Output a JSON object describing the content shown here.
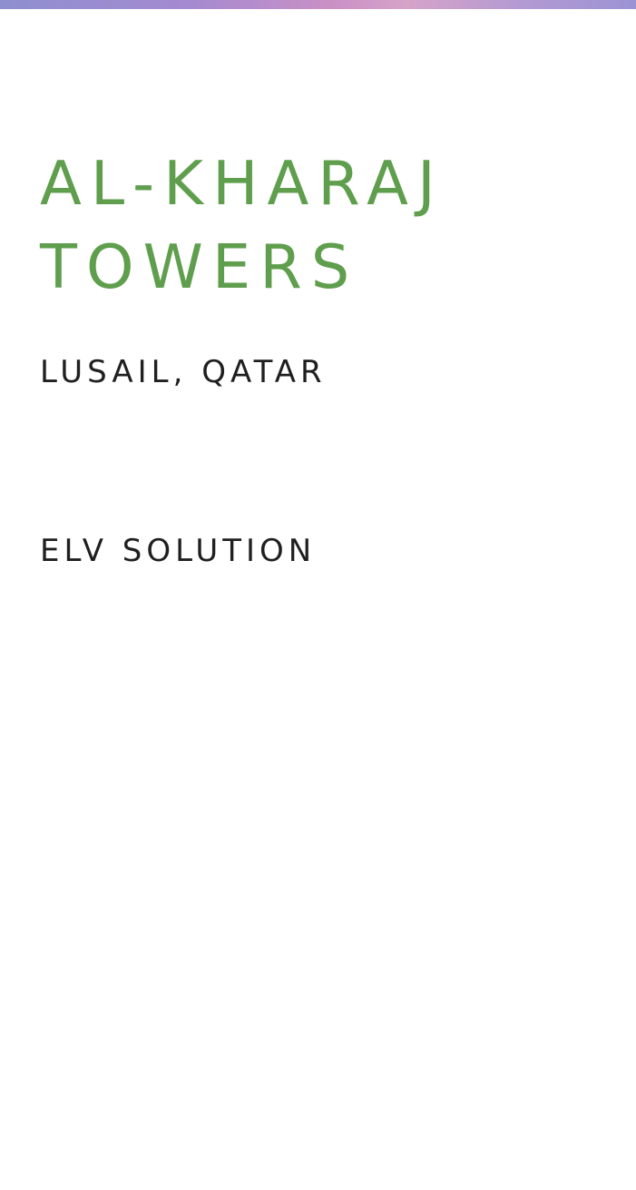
{
  "project": {
    "title_line_1": "AL-KHARAJ",
    "title_line_2": "TOWERS",
    "location": "LUSAIL, QATAR",
    "service": "ELV SOLUTION"
  },
  "colors": {
    "title": "#5e9e4d",
    "text": "#1f1f1f",
    "background": "#ffffff",
    "banner_gradient": [
      "#8e8fcf",
      "#c990c6",
      "#9b93d4"
    ]
  }
}
